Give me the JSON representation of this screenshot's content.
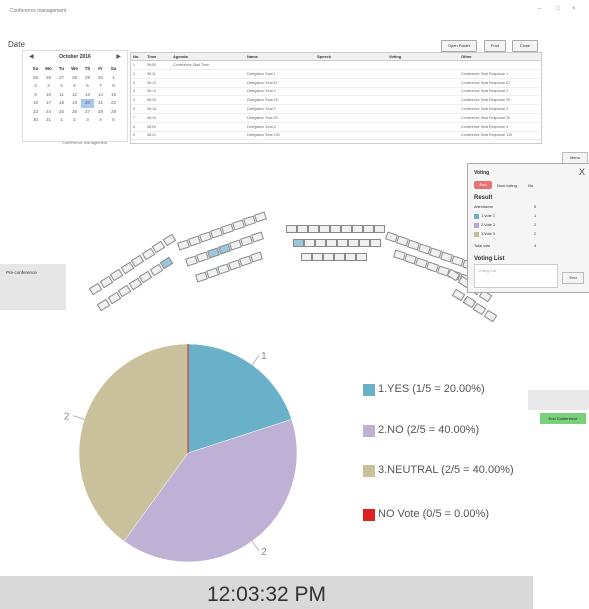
{
  "window": {
    "title": "Conference management",
    "controls": [
      "–",
      "□",
      "×"
    ]
  },
  "date_section": {
    "label": "Date"
  },
  "calendar": {
    "month_label": "October 2016",
    "prev": "◀",
    "next": "▶",
    "weekdays": [
      "Su",
      "Mo",
      "Tu",
      "We",
      "Th",
      "Fr",
      "Sa"
    ],
    "days": [
      "25",
      "26",
      "27",
      "28",
      "29",
      "30",
      "1",
      "2",
      "3",
      "4",
      "5",
      "6",
      "7",
      "8",
      "9",
      "10",
      "11",
      "12",
      "13",
      "14",
      "15",
      "16",
      "17",
      "18",
      "19",
      "20",
      "21",
      "22",
      "23",
      "24",
      "25",
      "26",
      "27",
      "28",
      "29",
      "30",
      "31",
      "1",
      "2",
      "3",
      "4",
      "5"
    ],
    "selected_day": "20",
    "footer": "Conference management"
  },
  "toolbar": {
    "open_folder": "Open Folder",
    "print": "Print",
    "close": "Close"
  },
  "table": {
    "headers": [
      "No.",
      "Time",
      "Agenda",
      "Name",
      "Speech",
      "Voting",
      "Other"
    ],
    "rows": [
      [
        "1",
        "08:00",
        "Conference Start Time",
        "",
        "",
        "",
        ""
      ],
      [
        "2",
        "08:11",
        "",
        "Delegation Seat 1",
        "",
        "",
        "Conference Seat Response 1"
      ],
      [
        "3",
        "08:13",
        "",
        "Delegation Seat 67",
        "",
        "",
        "Conference Seat Response 67"
      ],
      [
        "4",
        "08:14",
        "",
        "Delegation Seat 2",
        "",
        "",
        "Conference Seat Response 2"
      ],
      [
        "5",
        "08:16",
        "",
        "Delegation Seat 29",
        "",
        "",
        "Conference Seat Response 29"
      ],
      [
        "6",
        "08:18",
        "",
        "Delegation Seat 3",
        "",
        "",
        "Conference Seat Response 3"
      ],
      [
        "7",
        "08:19",
        "",
        "Delegation Seat 30",
        "",
        "",
        "Conference Seat Response 30"
      ],
      [
        "8",
        "08:20",
        "",
        "Delegation Seat 4",
        "",
        "",
        "Conference Seat Response 4"
      ],
      [
        "9",
        "08:21",
        "",
        "Delegation Seat 130",
        "",
        "",
        "Conference Seat Response 130"
      ]
    ]
  },
  "right_small": {
    "menu": "Menu",
    "end": "End"
  },
  "voting_panel": {
    "title": "Voting",
    "close": "X",
    "end_button": "End",
    "status_now": "Now voting",
    "status_value": "No",
    "result_title": "Result",
    "attendance_label": "Attendance",
    "attendance_value": "5",
    "options": [
      {
        "label": "1.Vote 1",
        "count": "1",
        "color": "#6bb0c8"
      },
      {
        "label": "2.Vote 2",
        "count": "2",
        "color": "#b8a9d2"
      },
      {
        "label": "3.Vote 3",
        "count": "2",
        "color": "#c8bf99"
      }
    ],
    "total_label": "Total vote",
    "total_value": "4",
    "list_title": "Voting List",
    "list_placeholder": "Voting List"
  },
  "pre_conference": {
    "label": "Pre-conference"
  },
  "end_conference": {
    "label": "End Conference"
  },
  "chart_data": {
    "type": "pie",
    "slices": [
      {
        "name": "1.YES",
        "value": 1,
        "color": "#68b1c9",
        "legend": "1.YES (1/5 = 20.00%)",
        "label": "1"
      },
      {
        "name": "2.NO",
        "value": 2,
        "color": "#bfb1d6",
        "legend": "2.NO (2/5 = 40.00%)",
        "label": "2"
      },
      {
        "name": "3.NEUTRAL",
        "value": 2,
        "color": "#c9c19c",
        "legend": "3.NEUTRAL (2/5 = 40.00%)",
        "label": "2"
      },
      {
        "name": "NO Vote",
        "value": 0,
        "color": "#e02020",
        "legend": "NO Vote (0/5 = 0.00%)",
        "label": ""
      }
    ],
    "total": 5
  },
  "clock": {
    "time": "12:03:32 PM"
  }
}
